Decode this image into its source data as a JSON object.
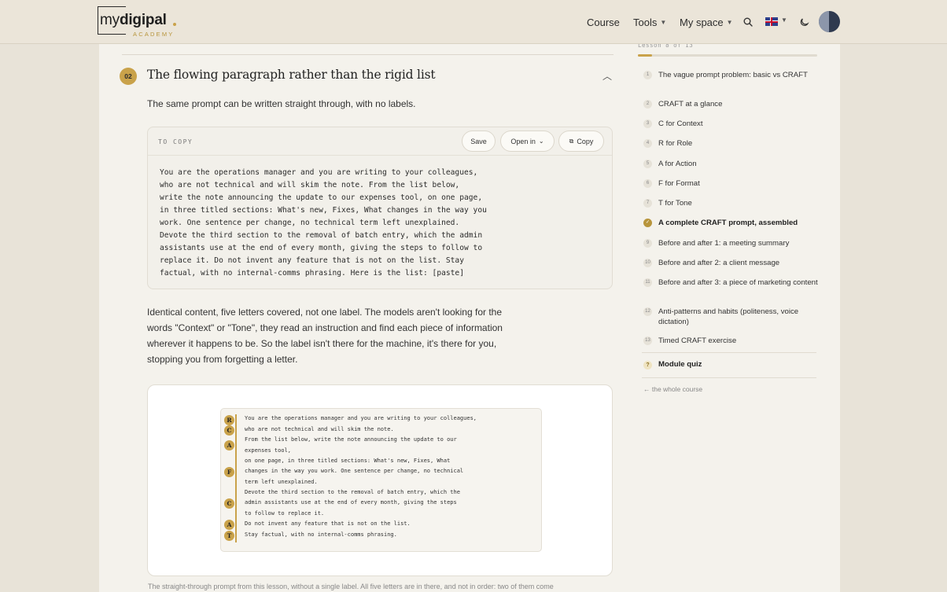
{
  "header": {
    "logo_prefix": "my",
    "logo_bold": "digipal",
    "logo_sub": "ACADEMY",
    "nav": {
      "course": "Course",
      "tools": "Tools",
      "my_space": "My space"
    },
    "language": "English",
    "icons": {
      "search": "search-icon",
      "flag": "uk-flag-icon",
      "theme": "moon-icon"
    }
  },
  "section": {
    "number": "02",
    "title": "The flowing paragraph rather than the rigid list",
    "intro": "The same prompt can be written straight through, with no labels."
  },
  "copy_block": {
    "label": "TO COPY",
    "save": "Save",
    "open_in": "Open in",
    "copy": "Copy",
    "lines": [
      "You are the operations manager and you are writing to your colleagues,",
      "who are not technical and will skim the note. From the list below,",
      "write the note announcing the update to our expenses tool, on one page,",
      "in three titled sections: What's new, Fixes, What changes in the way you",
      "work. One sentence per change, no technical term left unexplained.",
      "Devote the third section to the removal of batch entry, which the admin",
      "assistants use at the end of every month, giving the steps to follow to",
      "replace it. Do not invent any feature that is not on the list. Stay",
      "factual, with no internal-comms phrasing. Here is the list: [paste]"
    ]
  },
  "explanation": [
    "Identical content, five letters covered, not one label. The models aren't looking for the",
    "words \"Context\" or \"Tone\", they read an instruction and find each piece of information",
    "wherever it happens to be. So the label isn't there for the machine, it's there for you,",
    "stopping you from forgetting a letter."
  ],
  "figure": {
    "markers": [
      "R",
      "C",
      "A",
      "F",
      "C",
      "A",
      "T"
    ],
    "lines": [
      "You are the operations manager and you are writing to your colleagues,",
      "who are not technical and will skim the note.",
      "From the list below, write the note announcing the update to our",
      "expenses tool,",
      "on one page, in three titled sections: What's new, Fixes, What",
      "changes in the way you work. One sentence per change, no technical",
      "term left unexplained.",
      "Devote the third section to the removal of batch entry, which the",
      "admin assistants use at the end of every month, giving the steps",
      "to follow to replace it.",
      "Do not invent any feature that is not on the list.",
      "Stay factual, with no internal-comms phrasing."
    ],
    "caption": "The straight-through prompt from this lesson, without a single label. All five letters are in there, and not in order: two of them come"
  },
  "sidebar": {
    "lesson_count": "Lesson 8 of 13",
    "progress": 0.08,
    "lessons": [
      {
        "num": "1",
        "label": "The vague prompt problem: basic vs CRAFT"
      },
      {
        "num": "2",
        "label": "CRAFT at a glance"
      },
      {
        "num": "3",
        "label": "C for Context"
      },
      {
        "num": "4",
        "label": "R for Role"
      },
      {
        "num": "5",
        "label": "A for Action"
      },
      {
        "num": "6",
        "label": "F for Format"
      },
      {
        "num": "7",
        "label": "T for Tone"
      },
      {
        "num": "✓",
        "label": "A complete CRAFT prompt, assembled"
      },
      {
        "num": "9",
        "label": "Before and after 1: a meeting summary"
      },
      {
        "num": "10",
        "label": "Before and after 2: a client message"
      },
      {
        "num": "11",
        "label": "Before and after 3: a piece of marketing content"
      },
      {
        "num": "12",
        "label": "Anti-patterns and habits (politeness, voice dictation)"
      },
      {
        "num": "13",
        "label": "Timed CRAFT exercise"
      }
    ],
    "quiz_badge": "?",
    "quiz": "Module quiz",
    "back": "← the whole course"
  }
}
